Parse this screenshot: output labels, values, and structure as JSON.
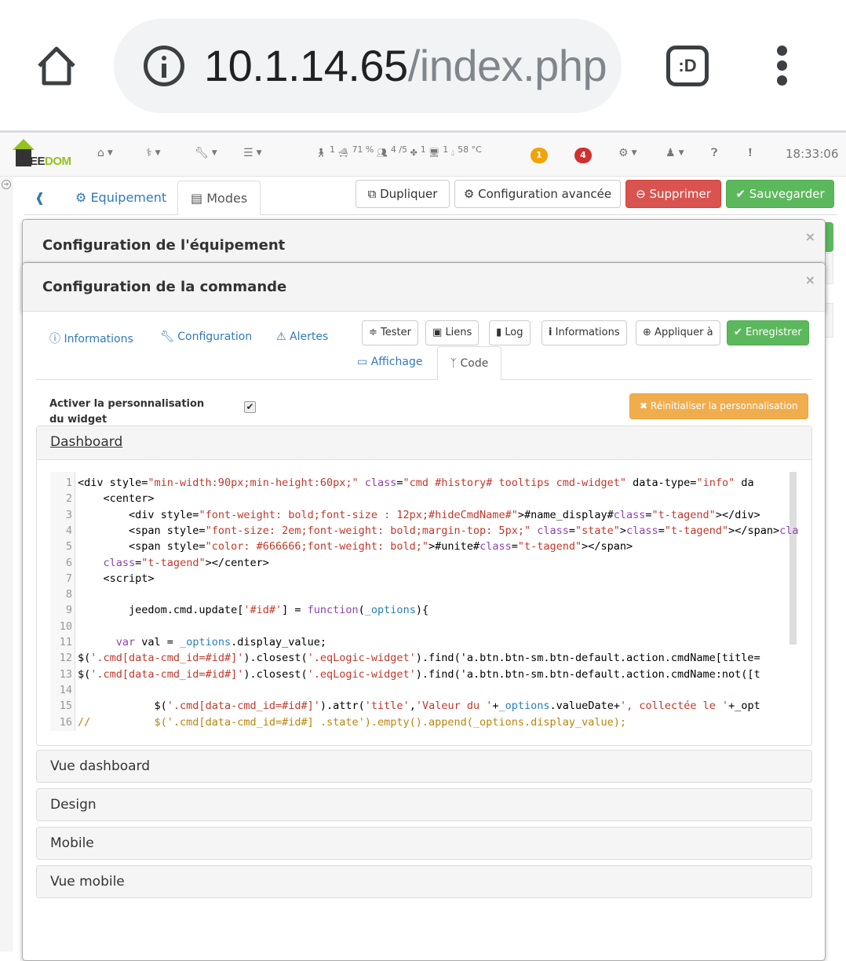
{
  "browser": {
    "url_host": "10.1.14.65",
    "url_path": "/index.php",
    "tabs_button": ":D",
    "icons": [
      "home-icon",
      "info-icon",
      "tabs-icon",
      "menu-icon"
    ]
  },
  "navbar": {
    "logo_text_1": "EE",
    "logo_text_2": "DOM",
    "menus": [
      {
        "icon": "home-icon",
        "glyph": "⌂"
      },
      {
        "icon": "stethoscope-icon",
        "glyph": "⚕"
      },
      {
        "icon": "wrench-icon",
        "glyph": "🔧"
      },
      {
        "icon": "bars-icon",
        "glyph": "☰"
      }
    ],
    "status": [
      {
        "icon": "motion-icon",
        "glyph": "🚶",
        "value": "1"
      },
      {
        "icon": "bath-icon",
        "glyph": "🛁",
        "value": "71 %"
      },
      {
        "icon": "people-icon",
        "glyph": "👥",
        "value": "4 /5"
      },
      {
        "icon": "fan-icon",
        "glyph": "✤",
        "value": "1"
      },
      {
        "icon": "computer-icon",
        "glyph": "🖥",
        "value": "1"
      },
      {
        "icon": "drop-icon",
        "glyph": "💧",
        "value": "58 °C"
      }
    ],
    "badge_orange": "1",
    "badge_red": "4",
    "clock": "18:33:06"
  },
  "tabs_top": {
    "back_icon": "back-icon",
    "equipement": "Equipement",
    "modes": "Modes"
  },
  "actions": {
    "dupliquer": "Dupliquer",
    "config_avancee": "Configuration avancée",
    "supprimer": "Supprimer",
    "sauvegarder": "Sauvegarder"
  },
  "modal_equipement": {
    "title": "Configuration de l'équipement",
    "close": "×"
  },
  "modal_commande": {
    "title": "Configuration de la commande",
    "close": "×",
    "tabs": {
      "informations": "Informations",
      "configuration": "Configuration",
      "alertes": "Alertes",
      "affichage": "Affichage",
      "code": "Code"
    },
    "buttons": {
      "tester": "Tester",
      "liens": "Liens",
      "log": "Log",
      "informations": "Informations",
      "appliquer": "Appliquer à",
      "enregistrer": "Enregistrer"
    },
    "activer_label": "Activer la personnalisation du widget",
    "activer_checked": true,
    "reset_button": "Réinitialiser la personnalisation",
    "panels": {
      "dashboard": "Dashboard",
      "vue_dashboard": "Vue dashboard",
      "design": "Design",
      "mobile": "Mobile",
      "vue_mobile": "Vue mobile"
    },
    "code_lines": [
      "<div style=\"min-width:90px;min-height:60px;\" class=\"cmd #history# tooltips cmd-widget\" data-type=\"info\" da",
      "    <center>",
      "        <div style=\"font-weight: bold;font-size : 12px;#hideCmdName#\">#name_display#</div>",
      "        <span style=\"font-size: 2em;font-weight: bold;margin-top: 5px;\" class=\"state\"></span><br/>",
      "        <span style=\"color: #666666;font-weight: bold;\">#unite#</span>",
      "    </center>",
      "    <script>",
      "",
      "        jeedom.cmd.update['#id#'] = function(_options){",
      "",
      "      var val = _options.display_value;",
      "$('.cmd[data-cmd_id=#id#]').closest('.eqLogic-widget').find('a.btn.btn-sm.btn-default.action.cmdName[title=",
      "$('.cmd[data-cmd_id=#id#]').closest('.eqLogic-widget').find('a.btn.btn-sm.btn-default.action.cmdName:not([t",
      "",
      "            $('.cmd[data-cmd_id=#id#]').attr('title','Valeur du '+_options.valueDate+', collectée le '+_opt",
      "//          $('.cmd[data-cmd_id=#id#] .state').empty().append(_options.display_value);"
    ]
  }
}
